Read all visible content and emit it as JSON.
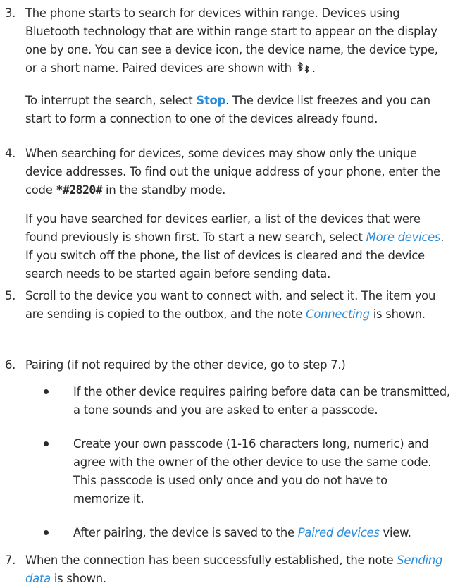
{
  "steps": [
    {
      "number": "3.",
      "p1_a": "The phone starts to search for devices within range. Devices using Bluetooth technology that are within range start to appear on the display one by one. You can see a device icon, the device name, the device type, or a short name. Paired devices are shown with",
      "p1_icon": "bluetooth-paired-icon",
      "p1_b": ".",
      "p2_a": "To interrupt the search, select ",
      "p2_link": "Stop",
      "p2_b": ". The device list freezes and you can start to form a connection to one of the devices already found."
    },
    {
      "number": "4.",
      "p1_a": "When searching for devices, some devices may show only the unique device addresses. To find out the unique address of your phone, enter the code ",
      "p1_code": "*#2820#",
      "p1_b": " in the standby mode.",
      "p2_a": "If you have searched for devices earlier, a list of the devices that were found previously is shown first. To start a new search, select ",
      "p2_link": "More devices",
      "p2_b": ". If you switch off the phone, the list of devices is cleared and the device search needs to be started again before sending data."
    },
    {
      "number": "5.",
      "p1_a": "Scroll to the device you want to connect with, and select it. The item you are sending is copied to the outbox, and the note ",
      "p1_link": "Connecting",
      "p1_b": " is shown."
    },
    {
      "number": "6.",
      "p1": "Pairing (if not required by the other device, go to step 7.)",
      "bullets": [
        "If the other device requires pairing before data can be transmitted, a tone sounds and you are asked to enter a passcode.",
        "Create your own passcode (1-16 characters long, numeric) and agree with the owner of the other device to use the same code. This passcode is used only once and you do not have to memorize it."
      ],
      "bullet3_a": "After pairing, the device is saved to the ",
      "bullet3_link": "Paired devices",
      "bullet3_b": " view."
    },
    {
      "number": "7.",
      "p1_a": "When the connection has been successfully established, the note ",
      "p1_link": "Sending data",
      "p1_b": " is shown."
    }
  ]
}
